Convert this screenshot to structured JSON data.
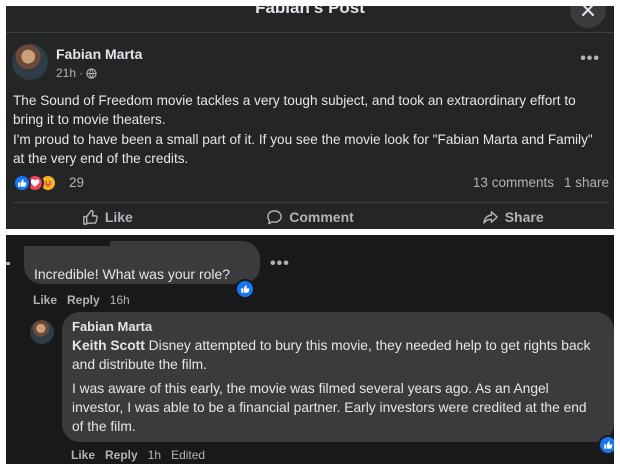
{
  "dialog": {
    "title": "Fabian's Post"
  },
  "post": {
    "author": "Fabian Marta",
    "time": "21h",
    "paragraphs": [
      "The Sound of Freedom movie tackles a very tough subject, and took an extraordinary effort to bring it to movie theaters.",
      "I'm proud to have been a small part of it. If you see the movie look for \"Fabian Marta and Family\" at the very end of the credits."
    ],
    "reaction_count": "29",
    "comments_count": "13 comments",
    "shares_count": "1 share",
    "actions": {
      "like": "Like",
      "comment": "Comment",
      "share": "Share"
    }
  },
  "comments": [
    {
      "text": "Incredible! What was your role?",
      "actions": {
        "like": "Like",
        "reply": "Reply",
        "time": "16h"
      }
    },
    {
      "author": "Fabian Marta",
      "mention": "Keith Scott",
      "text1": " Disney attempted to bury this movie, they needed help to get rights back and distribute the film.",
      "text2": "I was aware of this early, the movie was filmed several years ago. As an Angel investor, I was able to be a financial partner. Early investors were credited at the end of the film.",
      "actions": {
        "like": "Like",
        "reply": "Reply",
        "time": "1h",
        "edited": "Edited"
      }
    }
  ],
  "colors": {
    "accent": "#1877f2",
    "panel": "#242526",
    "bubble": "#3a3b3c"
  }
}
